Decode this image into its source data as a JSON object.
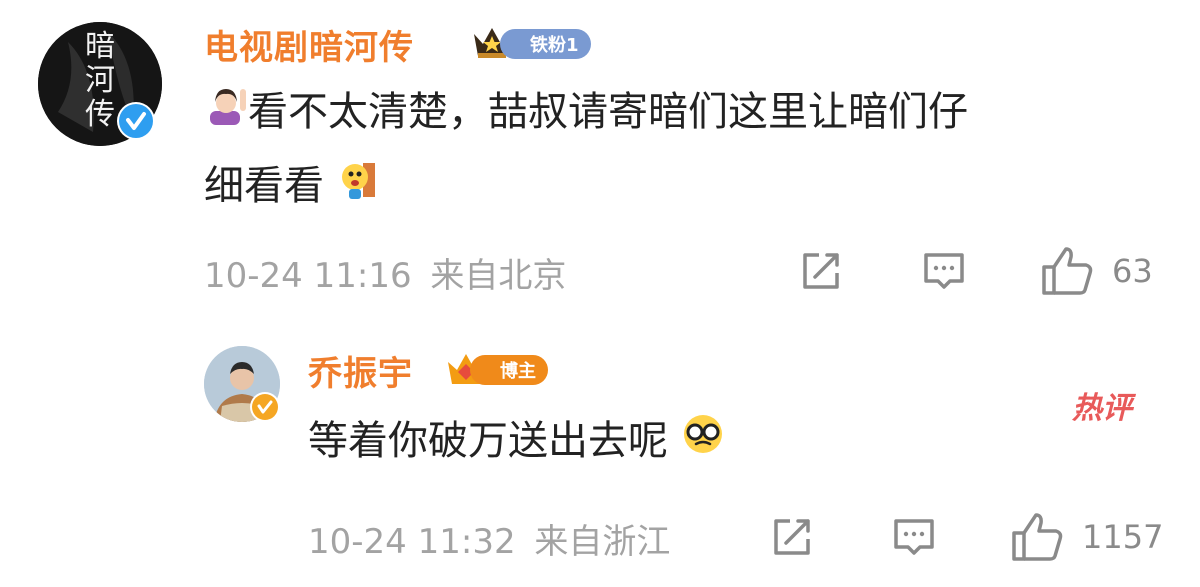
{
  "comment": {
    "author": "电视剧暗河传",
    "avatar_text": "暗河传",
    "badge": "铁粉1",
    "text_line1": "看不太清楚，喆叔请寄暗们这里让暗们仔",
    "text_line2": "细看看",
    "timestamp": "10-24 11:16",
    "location": "来自北京",
    "like_count": "63"
  },
  "reply": {
    "author": "乔振宇",
    "badge": "博主",
    "text": "等着你破万送出去呢",
    "timestamp": "10-24 11:32",
    "location": "来自浙江",
    "like_count": "1157",
    "hot_label": "热评"
  },
  "colors": {
    "name": "#f07e2d",
    "meta": "#a3a3a3",
    "badge_fan": "#7a9ad2",
    "badge_blogger": "#f08a1a",
    "hot": "#e85a5a"
  }
}
